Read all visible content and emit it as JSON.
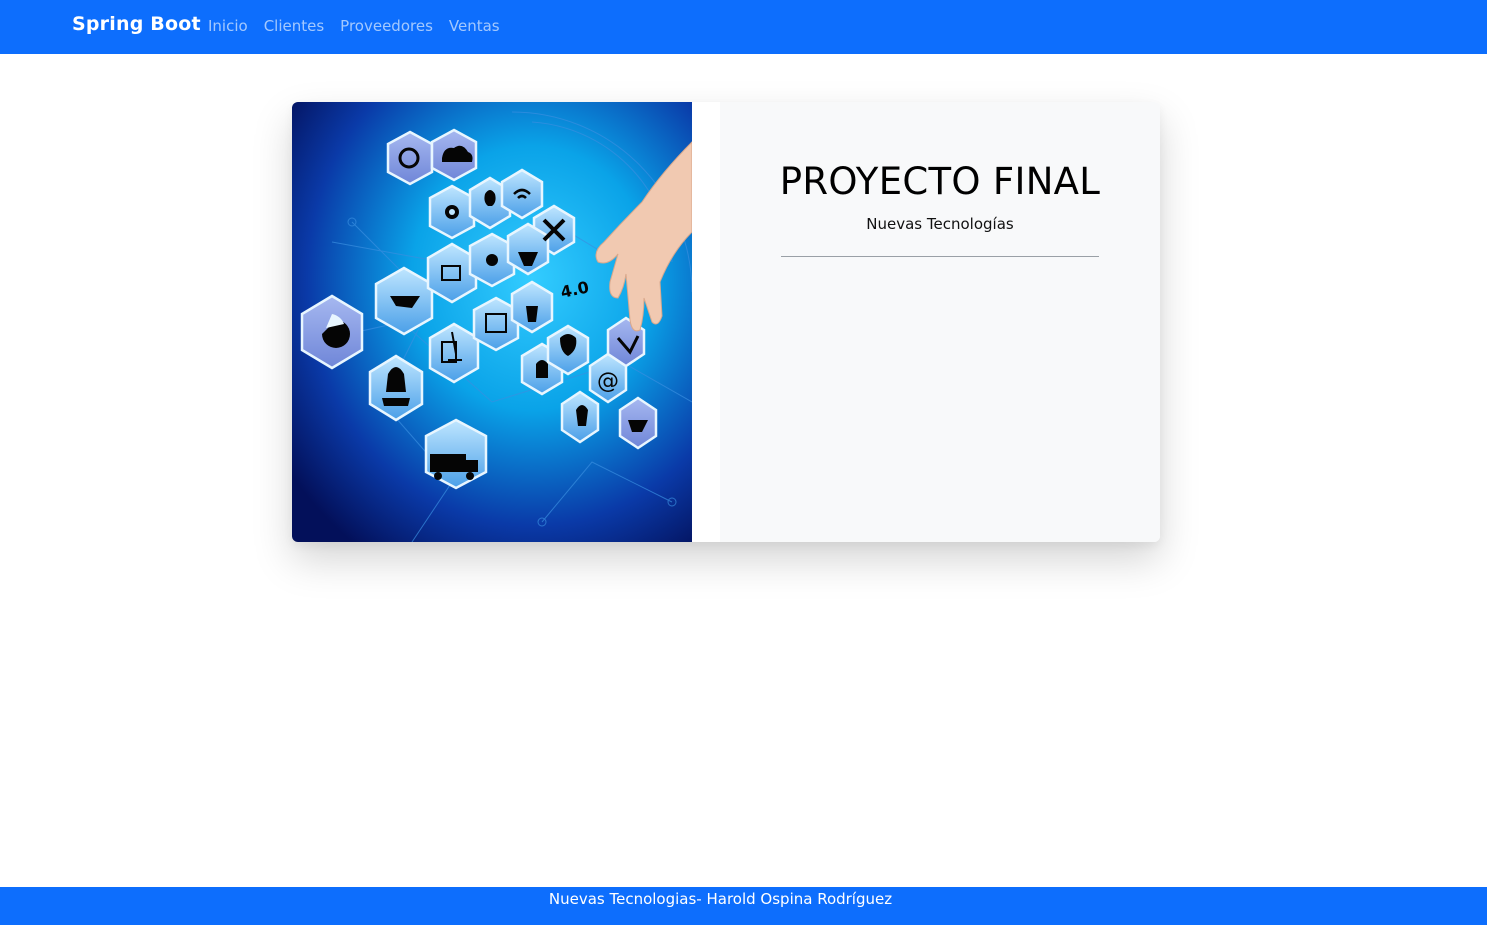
{
  "navbar": {
    "brand": "Spring Boot",
    "links": [
      "Inicio",
      "Clientes",
      "Proveedores",
      "Ventas"
    ],
    "background": "#0d6efd"
  },
  "hero": {
    "image": "technology-hexagon-icons-hand",
    "badge": "4.0"
  },
  "panel": {
    "title": "PROYECTO FINAL",
    "subtitle": "Nuevas Tecnologías"
  },
  "footer": {
    "text": "Nuevas Tecnologias- Harold Ospina Rodríguez",
    "background": "#0d6efd"
  }
}
